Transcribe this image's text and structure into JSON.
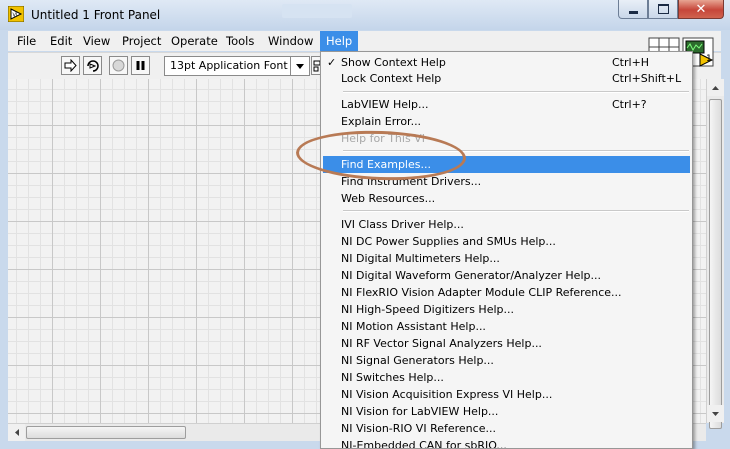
{
  "window": {
    "title": "Untitled 1 Front Panel",
    "close_glyph": "✕"
  },
  "menubar": {
    "items": [
      {
        "label": "File"
      },
      {
        "label": "Edit"
      },
      {
        "label": "View"
      },
      {
        "label": "Project"
      },
      {
        "label": "Operate"
      },
      {
        "label": "Tools"
      },
      {
        "label": "Window"
      },
      {
        "label": "Help"
      }
    ]
  },
  "toolbar": {
    "font_value": "13pt Application Font"
  },
  "vi_icon": {
    "pane_number": "1"
  },
  "help_menu": {
    "items": [
      {
        "label": "Show Context Help",
        "shortcut": "Ctrl+H",
        "checked": "✓"
      },
      {
        "label": "Lock Context Help",
        "shortcut": "Ctrl+Shift+L"
      },
      {
        "label": "LabVIEW Help...",
        "shortcut": "Ctrl+?"
      },
      {
        "label": "Explain Error..."
      },
      {
        "label": "Help for This VI"
      },
      {
        "label": "Find Examples..."
      },
      {
        "label": "Find Instrument Drivers..."
      },
      {
        "label": "Web Resources..."
      },
      {
        "label": "IVI Class Driver Help..."
      },
      {
        "label": "NI DC Power Supplies and SMUs Help..."
      },
      {
        "label": "NI Digital Multimeters Help..."
      },
      {
        "label": "NI Digital Waveform Generator/Analyzer Help..."
      },
      {
        "label": "NI FlexRIO Vision Adapter Module CLIP Reference..."
      },
      {
        "label": "NI High-Speed Digitizers Help..."
      },
      {
        "label": "NI Motion Assistant Help..."
      },
      {
        "label": "NI RF Vector Signal Analyzers Help..."
      },
      {
        "label": "NI Signal Generators Help..."
      },
      {
        "label": "NI Switches Help..."
      },
      {
        "label": "NI Vision Acquisition Express VI Help..."
      },
      {
        "label": "NI Vision for LabVIEW Help..."
      },
      {
        "label": "NI Vision-RIO VI Reference..."
      },
      {
        "label": "NI-Embedded CAN for sbRIO..."
      }
    ]
  },
  "colors": {
    "highlight": "#3b8ee8",
    "annotation": "#b87a55"
  }
}
